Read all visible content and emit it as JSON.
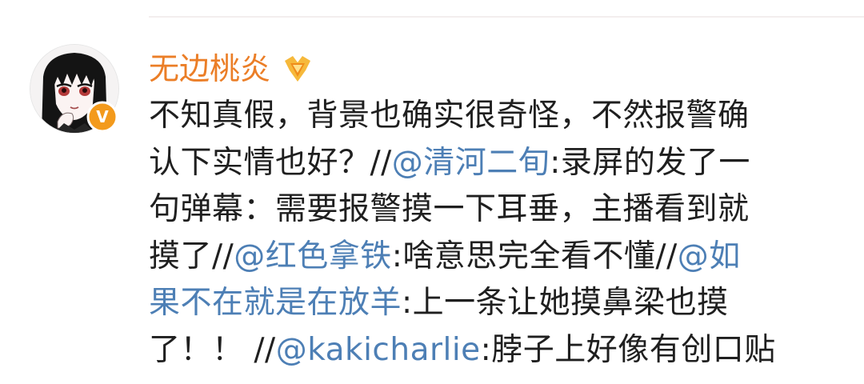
{
  "post": {
    "username": "无边桃炎",
    "avatar_icon": "anime-girl-avatar",
    "verified_icon": "verified-v-badge",
    "verified_letter": "V",
    "level_icon": "gold-member-badge",
    "colors": {
      "username": "#eb7e27",
      "mention": "#4d7fb5",
      "text": "#1f1f1f",
      "verified_badge": "#f39a1c"
    },
    "lines": [
      [
        {
          "text": "不知真假，背景也确实很奇怪，不然报警确",
          "mention": false
        }
      ],
      [
        {
          "text": "认下实情也好？//",
          "mention": false
        },
        {
          "text": "@清河二旬",
          "mention": true
        },
        {
          "text": ":录屏的发了一",
          "mention": false
        }
      ],
      [
        {
          "text": "句弹幕：需要报警摸一下耳垂，主播看到就",
          "mention": false
        }
      ],
      [
        {
          "text": "摸了//",
          "mention": false
        },
        {
          "text": "@红色拿铁",
          "mention": true
        },
        {
          "text": ":啥意思完全看不懂//",
          "mention": false
        },
        {
          "text": "@如",
          "mention": true
        }
      ],
      [
        {
          "text": "果不在就是在放羊",
          "mention": true
        },
        {
          "text": ":上一条让她摸鼻梁也摸",
          "mention": false
        }
      ],
      [
        {
          "text": "了！！ //",
          "mention": false
        },
        {
          "text": "@kakicharlie",
          "mention": true
        },
        {
          "text": ":脖子上好像有创口贴",
          "mention": false
        }
      ]
    ]
  }
}
